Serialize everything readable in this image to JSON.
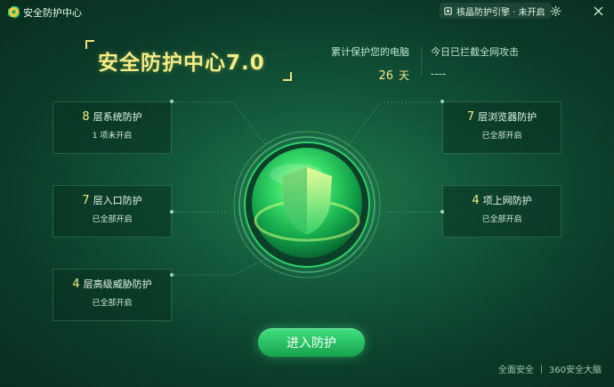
{
  "window": {
    "title": "安全防护中心"
  },
  "engine": {
    "label": "核晶防护引擎 · 未开启"
  },
  "icons": {
    "app": "360-logo-icon",
    "engine": "chip-icon",
    "settings": "gear-icon",
    "close": "close-icon",
    "shield": "shield-icon"
  },
  "header": {
    "title": "安全防护中心7.0",
    "protected_label": "累计保护您的电脑",
    "protected_days": "26",
    "protected_unit": "天",
    "attack_label": "今日已拦截全网攻击",
    "attack_value": "----"
  },
  "cards": {
    "system": {
      "num": "8",
      "title": "层系统防护",
      "status": "1 项未开启"
    },
    "entry": {
      "num": "7",
      "title": "层入口防护",
      "status": "已全部开启"
    },
    "threat": {
      "num": "4",
      "title": "层高级威胁防护",
      "status": "已全部开启"
    },
    "browser": {
      "num": "7",
      "title": "层浏览器防护",
      "status": "已全部开启"
    },
    "online": {
      "num": "4",
      "title": "项上网防护",
      "status": "已全部开启"
    }
  },
  "actions": {
    "enter": "进入防护"
  },
  "footer": {
    "link1": "全面安全",
    "link2": "360安全大脑"
  },
  "colors": {
    "accent_yellow": "#f6ec86",
    "button_green": "#2fcf6a",
    "background": "#0b3a28"
  }
}
